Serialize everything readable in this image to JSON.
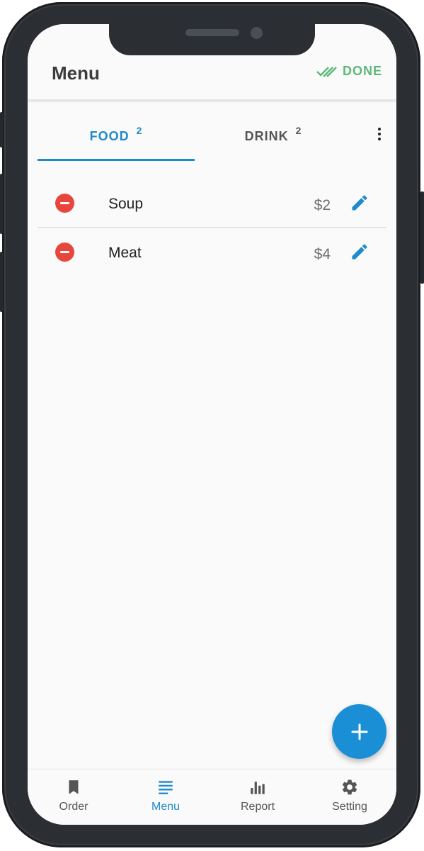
{
  "appbar": {
    "title": "Menu",
    "done_label": "DONE",
    "done_icon": "double-check-icon"
  },
  "tabs": [
    {
      "label": "FOOD",
      "count": "2",
      "active": true
    },
    {
      "label": "DRINK",
      "count": "2",
      "active": false
    }
  ],
  "items": [
    {
      "name": "Soup",
      "price": "$2"
    },
    {
      "name": "Meat",
      "price": "$4"
    }
  ],
  "fab": {
    "icon": "plus-icon"
  },
  "bottom_nav": [
    {
      "label": "Order",
      "icon": "bookmark-icon",
      "active": false
    },
    {
      "label": "Menu",
      "icon": "menu-lines-icon",
      "active": true
    },
    {
      "label": "Report",
      "icon": "bar-chart-icon",
      "active": false
    },
    {
      "label": "Setting",
      "icon": "gear-icon",
      "active": false
    }
  ],
  "colors": {
    "accent": "#1f8bcc",
    "done_green": "#5cb87a",
    "remove_red": "#e8453c",
    "fab_blue": "#1a8fd6",
    "device_frame": "#2b2e33"
  }
}
